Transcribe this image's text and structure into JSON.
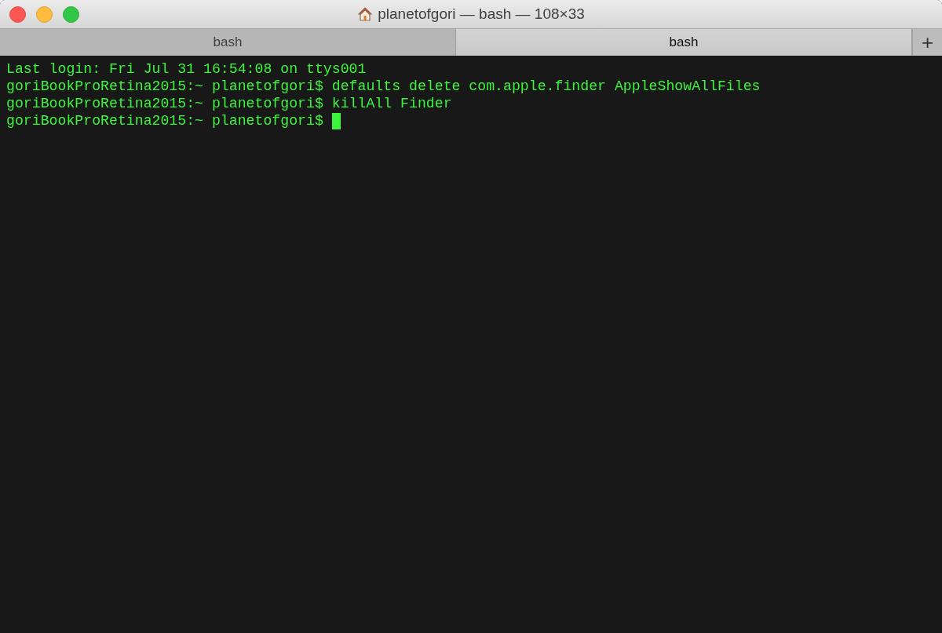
{
  "window": {
    "title": "planetofgori — bash — 108×33"
  },
  "tabs": [
    {
      "label": "bash",
      "selected": false
    },
    {
      "label": "bash",
      "selected": true
    }
  ],
  "new_tab_button": {
    "label": "+"
  },
  "terminal": {
    "lines": [
      "Last login: Fri Jul 31 16:54:08 on ttys001",
      "goriBookProRetina2015:~ planetofgori$ defaults delete com.apple.finder AppleShowAllFiles",
      "goriBookProRetina2015:~ planetofgori$ killAll Finder",
      "goriBookProRetina2015:~ planetofgori$ "
    ],
    "cursor_visible": true
  }
}
